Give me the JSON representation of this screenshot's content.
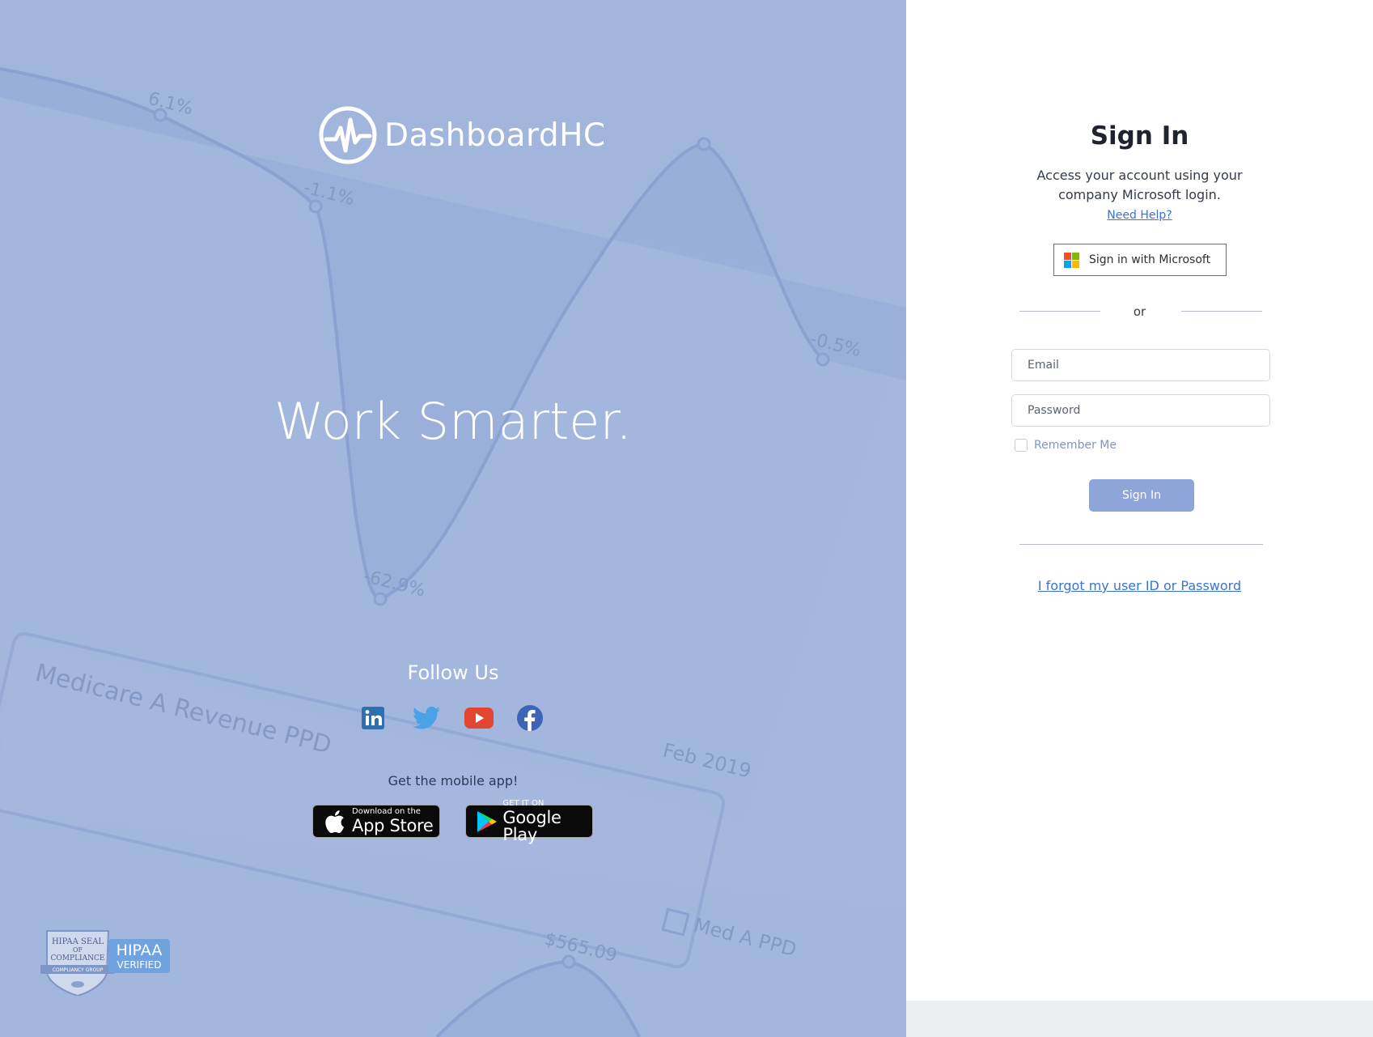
{
  "brand": {
    "name": "DashboardHC"
  },
  "hero": {
    "headline": "Work Smarter."
  },
  "background_art": {
    "labels": [
      "6.1%",
      "-1.1%",
      "-62.9%",
      "-0.5%",
      "Medicare A Revenue PPD",
      "Feb 2019",
      "$565.09",
      "Med A PPD"
    ]
  },
  "social": {
    "title": "Follow Us",
    "items": [
      "linkedin",
      "twitter",
      "youtube",
      "facebook"
    ]
  },
  "mobile": {
    "text": "Get the mobile app!",
    "app_store": {
      "small": "Download on the",
      "big": "App Store"
    },
    "google_play": {
      "small": "GET IT ON",
      "big": "Google Play"
    }
  },
  "badge": {
    "seal_lines": [
      "HIPAA SEAL",
      "OF",
      "COMPLIANCE",
      "COMPLIANCY GROUP"
    ],
    "hipaa": "HIPAA",
    "verified": "VERIFIED"
  },
  "signin": {
    "title": "Sign In",
    "desc_line1": "Access your account using your",
    "desc_line2": "company Microsoft login.",
    "help_link": "Need Help?",
    "microsoft_button": "Sign in with Microsoft",
    "or": "or",
    "email_placeholder": "Email",
    "password_placeholder": "Password",
    "remember_label": "Remember Me",
    "submit": "Sign In",
    "forgot_link": "I forgot my user ID or Password"
  },
  "colors": {
    "left_bg": "#a3b6de",
    "button_bg": "#8ea5d9",
    "link": "#3a73d8",
    "ms_red": "#f25022",
    "ms_green": "#7fba00",
    "ms_blue": "#00a4ef",
    "ms_yellow": "#ffb900"
  }
}
